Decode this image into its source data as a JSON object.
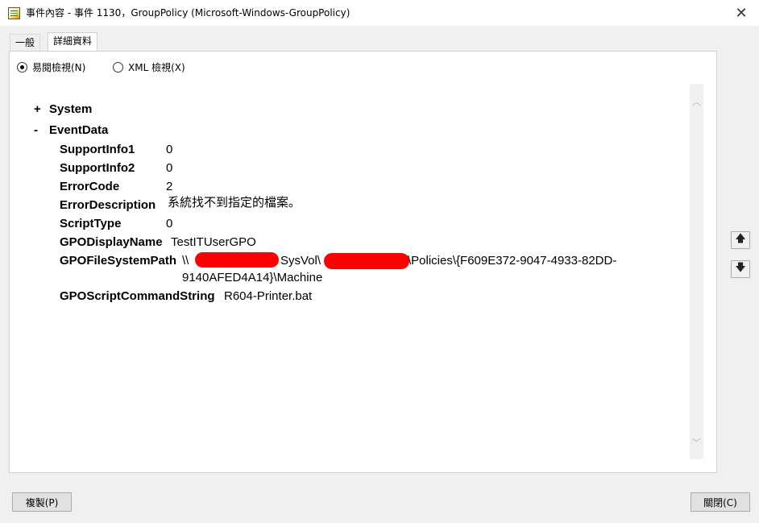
{
  "window": {
    "title": "事件內容 - 事件 1130，GroupPolicy (Microsoft-Windows-GroupPolicy)",
    "close_glyph": "✕"
  },
  "tabs": [
    {
      "label": "一般",
      "active": false
    },
    {
      "label": "詳細資料",
      "active": true
    }
  ],
  "view_options": {
    "friendly": {
      "label": "易閱檢視(N)",
      "selected": true
    },
    "xml": {
      "label": "XML 檢視(X)",
      "selected": false
    }
  },
  "tree": {
    "system": {
      "sign": "+",
      "label": "System"
    },
    "event_data": {
      "sign": "-",
      "label": "EventData"
    },
    "fields": [
      {
        "name": "SupportInfo1",
        "value": "0"
      },
      {
        "name": "SupportInfo2",
        "value": "0"
      },
      {
        "name": "ErrorCode",
        "value": "2"
      },
      {
        "name": "ErrorDescription",
        "value": "系統找不到指定的檔案。"
      },
      {
        "name": "ScriptType",
        "value": "0"
      },
      {
        "name": "GPODisplayName",
        "value": "TestITUserGPO"
      },
      {
        "name": "GPOFileSystemPath",
        "value_parts": [
          "\\\\",
          "SysVol\\",
          "\\Policies\\{F609E372-9047-4933-82DD-"
        ],
        "value_line2": "9140AFED4A14}\\Machine"
      },
      {
        "name": "GPOScriptCommandString",
        "value": "R604-Printer.bat"
      }
    ]
  },
  "side_buttons": {
    "up_icon": "arrow-up-icon",
    "down_icon": "arrow-down-icon"
  },
  "buttons": {
    "copy": "複製(P)",
    "close": "關閉(C)"
  },
  "colors": {
    "redaction": "#ff0000",
    "panel_bg": "#ffffff",
    "window_bg": "#f0f0f0"
  }
}
